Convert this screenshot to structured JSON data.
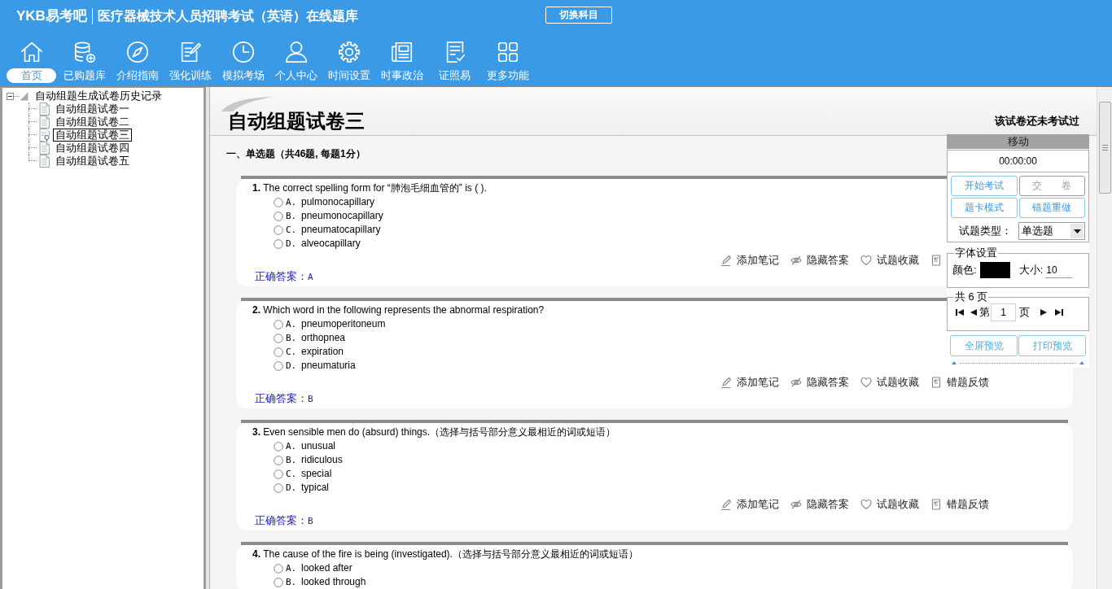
{
  "header": {
    "logo": "YKB易考吧",
    "title": "医疗器械技术人员招聘考试（英语）在线题库",
    "switch_button": "切换科目"
  },
  "nav": [
    {
      "label": "首页",
      "selected": true
    },
    {
      "label": "已购题库",
      "selected": false
    },
    {
      "label": "介绍指南",
      "selected": false
    },
    {
      "label": "强化训练",
      "selected": false
    },
    {
      "label": "模拟考场",
      "selected": false
    },
    {
      "label": "个人中心",
      "selected": false
    },
    {
      "label": "时间设置",
      "selected": false
    },
    {
      "label": "时事政治",
      "selected": false
    },
    {
      "label": "证照易",
      "selected": false
    },
    {
      "label": "更多功能",
      "selected": false
    }
  ],
  "tree": {
    "label": "自动组题生成试卷历史记录",
    "expanded": true,
    "children": [
      {
        "label": "自动组题试卷一",
        "selected": false
      },
      {
        "label": "自动组题试卷二",
        "selected": false
      },
      {
        "label": "自动组题试卷三",
        "selected": true
      },
      {
        "label": "自动组题试卷四",
        "selected": false
      },
      {
        "label": "自动组题试卷五",
        "selected": false
      }
    ]
  },
  "paper": {
    "title": "自动组题试卷三",
    "status": "该试卷还未考试过",
    "section": "一、单选题（共46题, 每题1分）"
  },
  "questions": [
    {
      "number": "1.",
      "text": "The correct spelling form for “肺泡毛细血管的” is ( ).",
      "options": [
        {
          "letter": "A.",
          "text": "pulmonocapillary",
          "selected": false
        },
        {
          "letter": "B.",
          "text": "pneumonocapillary",
          "selected": false
        },
        {
          "letter": "C.",
          "text": "pneumatocapillary",
          "selected": false
        },
        {
          "letter": "D.",
          "text": "alveocapillary",
          "selected": false
        }
      ],
      "actions": [
        {
          "kind": "note",
          "label": "添加笔记"
        },
        {
          "kind": "hide",
          "label": "隐藏答案"
        },
        {
          "kind": "favorite",
          "label": "试题收藏"
        },
        {
          "kind": "feedback"
        }
      ],
      "answer_label": "正确答案：",
      "answer": "A"
    },
    {
      "number": "2.",
      "text": "Which word in the following represents the abnormal respiration?",
      "options": [
        {
          "letter": "A.",
          "text": "pneumoperitoneum",
          "selected": false
        },
        {
          "letter": "B.",
          "text": "orthopnea",
          "selected": false
        },
        {
          "letter": "C.",
          "text": "expiration",
          "selected": false
        },
        {
          "letter": "D.",
          "text": "pneumaturia",
          "selected": false
        }
      ],
      "actions": [
        {
          "kind": "note",
          "label": "添加笔记"
        },
        {
          "kind": "hide",
          "label": "隐藏答案"
        },
        {
          "kind": "favorite",
          "label": "试题收藏"
        },
        {
          "kind": "feedback",
          "label": "错题反馈"
        }
      ],
      "answer_label": "正确答案：",
      "answer": "B"
    },
    {
      "number": "3.",
      "text": "Even sensible men do (absurd) things.（选择与括号部分意义最相近的词或短语）",
      "options": [
        {
          "letter": "A.",
          "text": "unusual",
          "selected": false
        },
        {
          "letter": "B.",
          "text": "ridiculous",
          "selected": false
        },
        {
          "letter": "C.",
          "text": "special",
          "selected": false
        },
        {
          "letter": "D.",
          "text": "typical",
          "selected": false
        }
      ],
      "actions": [
        {
          "kind": "note",
          "label": "添加笔记"
        },
        {
          "kind": "hide",
          "label": "隐藏答案"
        },
        {
          "kind": "favorite",
          "label": "试题收藏"
        },
        {
          "kind": "feedback",
          "label": "错题反馈"
        }
      ],
      "answer_label": "正确答案：",
      "answer": "B"
    },
    {
      "number": "4.",
      "text": "The cause of the fire is being (investigated).（选择与括号部分意义最相近的词或短语）",
      "options": [
        {
          "letter": "A.",
          "text": "looked after",
          "selected": false
        },
        {
          "letter": "B.",
          "text": "looked through",
          "selected": false
        }
      ]
    }
  ],
  "panel": {
    "header": "移动",
    "timer": "00:00:00",
    "buttons": [
      {
        "label": "开始考试",
        "disabled": false
      },
      {
        "label": "交　　卷",
        "disabled": true
      },
      {
        "label": "题卡模式",
        "disabled": false
      },
      {
        "label": "错题重做",
        "disabled": false
      }
    ],
    "type_label": "试题类型：",
    "type_value": "单选题",
    "font_settings": {
      "legend": "字体设置",
      "color_label": "颜色:",
      "color": "#000000",
      "size_label": "大小:",
      "size": "10"
    },
    "pager": {
      "legend": "共 6 页",
      "prefix": "第",
      "page": "1",
      "suffix": "页"
    },
    "preview_buttons": [
      "全屏预览",
      "打印预览"
    ]
  }
}
